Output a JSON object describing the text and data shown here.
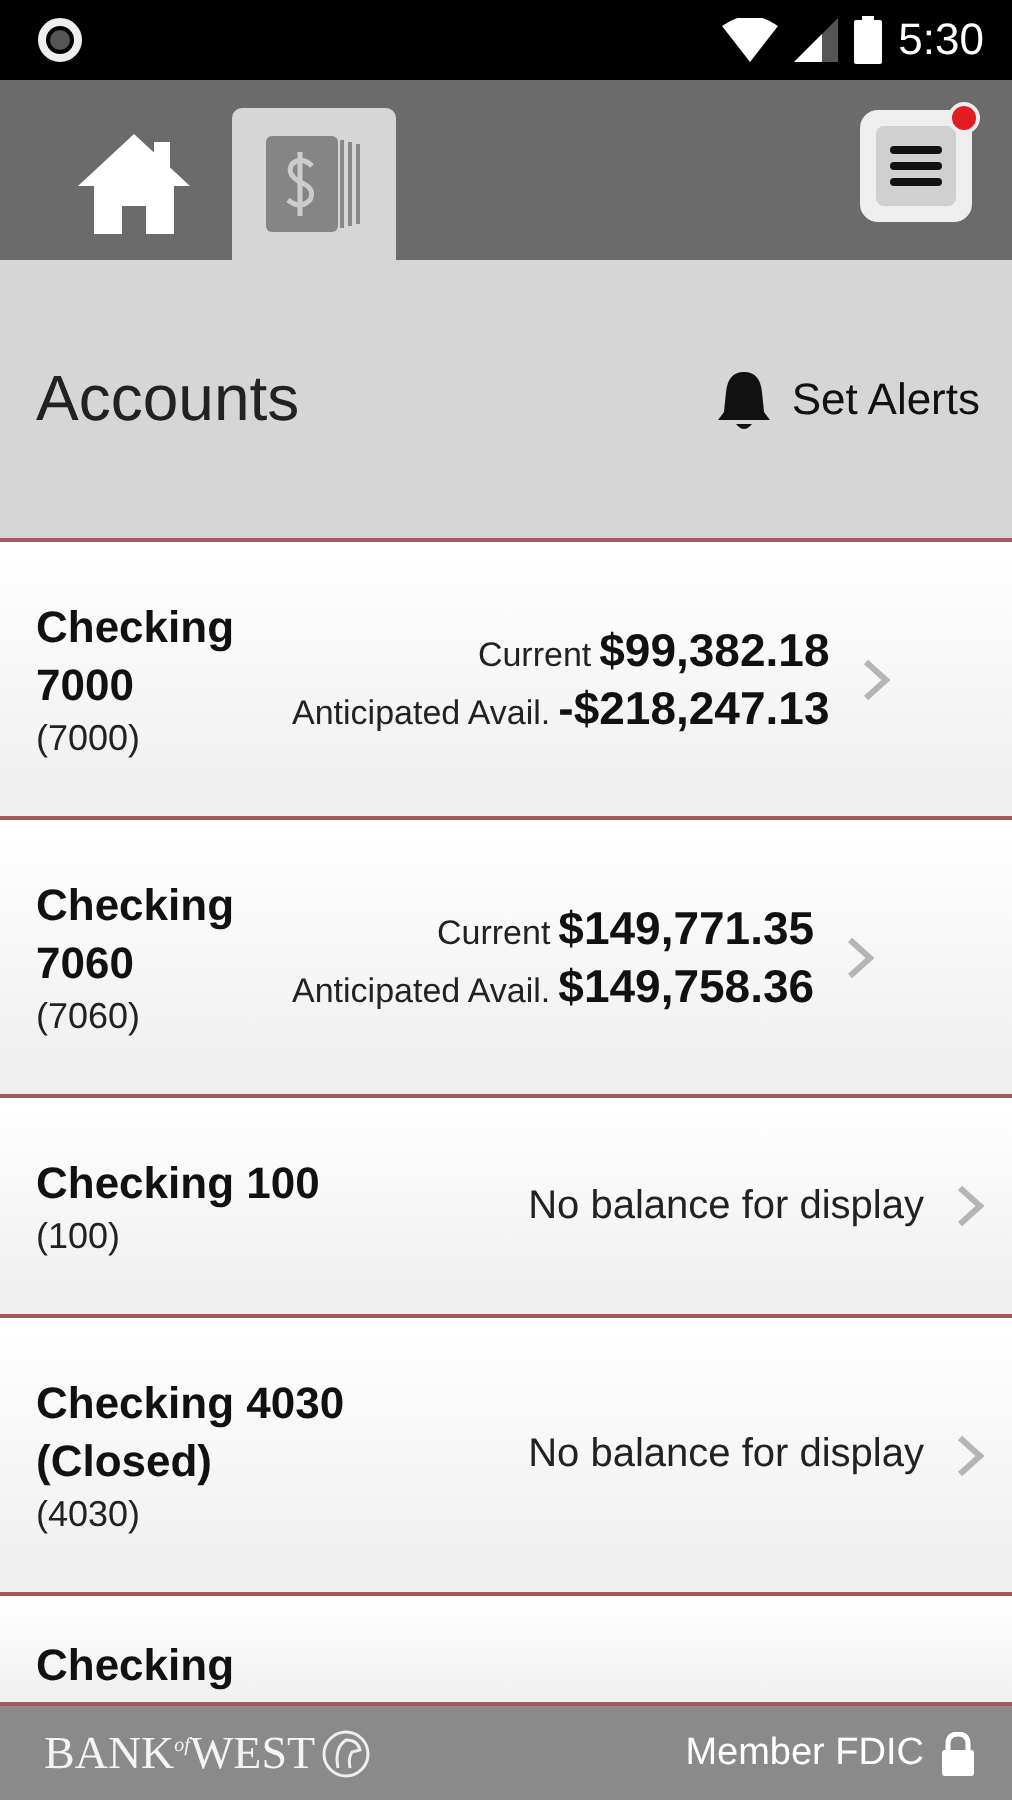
{
  "status_bar": {
    "time": "5:30"
  },
  "nav": {
    "tabs": [
      {
        "kind": "home",
        "selected": false
      },
      {
        "kind": "accounts",
        "selected": true
      }
    ],
    "menu": {
      "notification": true
    }
  },
  "header": {
    "title": "Accounts",
    "alerts_button": "Set Alerts"
  },
  "accounts": [
    {
      "kind": "balances",
      "name": "Checking 7000",
      "number": "(7000)",
      "current_label": "Current",
      "current": "$99,382.18",
      "anticipated_label": "Anticipated Avail.",
      "anticipated": "-$218,247.13"
    },
    {
      "kind": "balances",
      "name": "Checking 7060",
      "number": "(7060)",
      "current_label": "Current",
      "current": "$149,771.35",
      "anticipated_label": "Anticipated Avail.",
      "anticipated": "$149,758.36"
    },
    {
      "kind": "no_balance",
      "name": "Checking 100",
      "number": "(100)",
      "message": "No balance for display"
    },
    {
      "kind": "no_balance",
      "name": "Checking 4030 (Closed)",
      "number": "(4030)",
      "message": "No balance for display"
    },
    {
      "kind": "partial",
      "name": "Checking"
    }
  ],
  "footer": {
    "logo": "BANK$^{of}$WEST",
    "fdic": "Member FDIC"
  }
}
